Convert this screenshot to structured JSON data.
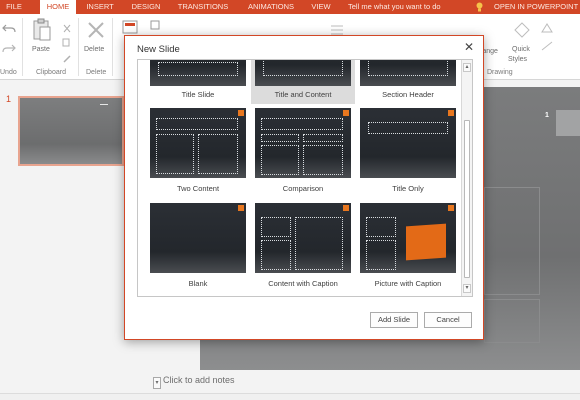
{
  "ribbon": {
    "tabs": [
      "FILE",
      "HOME",
      "INSERT",
      "DESIGN",
      "TRANSITIONS",
      "ANIMATIONS",
      "VIEW"
    ],
    "active_tab": "HOME",
    "tell_me": "Tell me what you want to do",
    "open_in": "OPEN IN POWERPOINT",
    "buttons": {
      "paste": "Paste",
      "delete": "Delete",
      "arrange": "range",
      "quick_styles_1": "Quick",
      "quick_styles_2": "Styles"
    },
    "groups": {
      "undo": "Undo",
      "clipboard": "Clipboard",
      "delete": "Delete",
      "drawing": "Drawing"
    },
    "accent_color": "#d24726"
  },
  "thumbnails": {
    "number": "1"
  },
  "slide": {
    "number": "1",
    "notes_placeholder": "Click to add notes",
    "notes_toggle": "▾"
  },
  "dialog": {
    "title": "New Slide",
    "close_glyph": "✕",
    "scroll_up": "▴",
    "scroll_down": "▾",
    "layouts": [
      {
        "name": "Title Slide",
        "selected": false
      },
      {
        "name": "Title and Content",
        "selected": true
      },
      {
        "name": "Section Header",
        "selected": false
      },
      {
        "name": "Two Content",
        "selected": false
      },
      {
        "name": "Comparison",
        "selected": false
      },
      {
        "name": "Title Only",
        "selected": false
      },
      {
        "name": "Blank",
        "selected": false
      },
      {
        "name": "Content with Caption",
        "selected": false
      },
      {
        "name": "Picture with Caption",
        "selected": false
      }
    ],
    "add_button": "Add Slide",
    "cancel_button": "Cancel",
    "thumb_accent_color": "#e8771f",
    "picture_color": "#e36a17"
  }
}
